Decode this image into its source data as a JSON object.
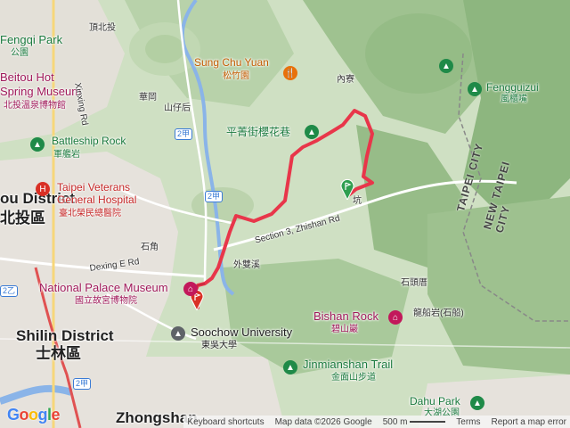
{
  "districts": {
    "beitou_en": "ou District",
    "beitou_zh": "北投區",
    "shilin_en": "Shilin District",
    "shilin_zh": "士林區",
    "zhongshan_en": "Zhongshan"
  },
  "places": {
    "fengqi_park_en": "Fengqi Park",
    "fengqi_park_zh": "公園",
    "dingbeitou": "頂北投",
    "beitou_museum_en_1": "Beitou Hot",
    "beitou_museum_en_2": "Spring Museum",
    "beitou_museum_zh": "北投溫泉博物館",
    "sung_chu_yuan_en": "Sung Chu Yuan",
    "sung_chu_yuan_zh": "松竹園",
    "neiliao": "內寮",
    "fengguizui_en": "Fengguizui",
    "fengguizui_zh": "風櫃嘴",
    "huagang": "華岡",
    "shanzihou": "山仔后",
    "pingjing_street": "平菁街櫻花巷",
    "battleship_rock_en": "Battleship Rock",
    "battleship_rock_zh": "軍艦岩",
    "veterans_hosp_en_1": "Taipei Veterans",
    "veterans_hosp_en_2": "General Hospital",
    "veterans_hosp_zh": "臺北榮民總醫院",
    "zhishan_rd": "Section 3, Zhishan Rd",
    "kang": "坑",
    "shijiao": "石角",
    "dexing_rd": "Dexing E Rd",
    "waishuangxi": "外雙溪",
    "palace_museum_en": "National Palace Museum",
    "palace_museum_zh": "國立故宮博物院",
    "soochow_en": "Soochow University",
    "soochow_zh": "東吳大學",
    "shitoucuo": "石頭厝",
    "bishan_rock_en": "Bishan Rock",
    "bishan_rock_zh": "碧山巖",
    "longchuanyan": "龍船岩(石船)",
    "jinmianshan_en": "Jinmianshan Trail",
    "jinmianshan_zh": "金面山步道",
    "dahu_park_en": "Dahu Park",
    "dahu_park_zh": "大湖公園",
    "xinxing_rd": "Xinxing Rd",
    "taipei_city": "TAIPEI CITY",
    "new_taipei_city": "NEW TAIPEI CITY"
  },
  "shields": {
    "r2a": "2甲",
    "r2a_b": "2甲",
    "r2a_c": "2甲",
    "r2yi": "2乙"
  },
  "footer": {
    "google": "Google",
    "keyboard": "Keyboard shortcuts",
    "map_data": "Map data ©2026 Google",
    "scale": "500 m",
    "terms": "Terms",
    "report": "Report a map error"
  },
  "colors": {
    "route": "#e8364a",
    "park": "#1f8a48",
    "museum": "#c2185b",
    "river": "#8ab4e8"
  },
  "icons": {
    "start_marker": "green-flag-pin-icon",
    "end_marker": "red-flag-pin-icon"
  }
}
